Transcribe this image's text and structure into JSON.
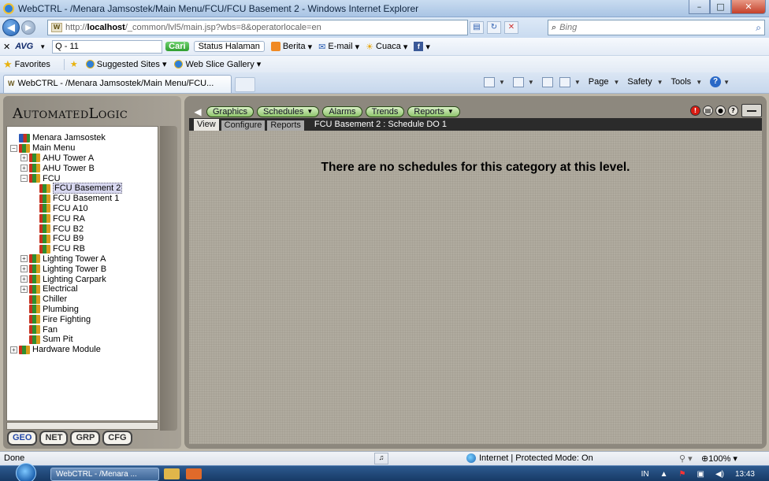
{
  "window": {
    "title": "WebCTRL - /Menara Jamsostek/Main Menu/FCU/FCU Basement 2 - Windows Internet Explorer"
  },
  "address_bar": {
    "url_prefix": "http://",
    "url_host": "localhost",
    "url_path": "/_common/lvl5/main.jsp?wbs=8&operatorlocale=en",
    "search_placeholder": "Bing"
  },
  "avg_toolbar": {
    "brand": "AVG",
    "search_value": "Q - 11",
    "cari_label": "Cari",
    "status_label": "Status Halaman",
    "berita_label": "Berita",
    "email_label": "E-mail",
    "cuaca_label": "Cuaca"
  },
  "favorites_bar": {
    "favorites_label": "Favorites",
    "suggested_label": "Suggested Sites",
    "webslice_label": "Web Slice Gallery"
  },
  "tab": {
    "label": "WebCTRL - /Menara Jamsostek/Main Menu/FCU..."
  },
  "command_bar": {
    "page_label": "Page",
    "safety_label": "Safety",
    "tools_label": "Tools"
  },
  "app": {
    "logo": "AutomatedLogic",
    "nav_buttons": [
      {
        "label": "Graphics",
        "has_menu": false
      },
      {
        "label": "Schedules",
        "has_menu": true
      },
      {
        "label": "Alarms",
        "has_menu": false
      },
      {
        "label": "Trends",
        "has_menu": false
      },
      {
        "label": "Reports",
        "has_menu": true
      }
    ],
    "subtabs": [
      "View",
      "Configure",
      "Reports"
    ],
    "active_subtab": "View",
    "breadcrumb": "FCU Basement 2 : Schedule DO 1",
    "message": "There are no schedules for this category at this level.",
    "tree": [
      {
        "label": "Menara Jamsostek",
        "indent": 0,
        "expander": "",
        "icon": "root"
      },
      {
        "label": "Main Menu",
        "indent": 0,
        "expander": "−",
        "icon": "building"
      },
      {
        "label": "AHU Tower A",
        "indent": 1,
        "expander": "+",
        "icon": "building"
      },
      {
        "label": "AHU Tower B",
        "indent": 1,
        "expander": "+",
        "icon": "building"
      },
      {
        "label": "FCU",
        "indent": 1,
        "expander": "−",
        "icon": "building"
      },
      {
        "label": "FCU Basement 2",
        "indent": 2,
        "expander": "",
        "icon": "building",
        "selected": true
      },
      {
        "label": "FCU Basement 1",
        "indent": 2,
        "expander": "",
        "icon": "building"
      },
      {
        "label": "FCU A10",
        "indent": 2,
        "expander": "",
        "icon": "building"
      },
      {
        "label": "FCU RA",
        "indent": 2,
        "expander": "",
        "icon": "building"
      },
      {
        "label": "FCU B2",
        "indent": 2,
        "expander": "",
        "icon": "building"
      },
      {
        "label": "FCU B9",
        "indent": 2,
        "expander": "",
        "icon": "building"
      },
      {
        "label": "FCU RB",
        "indent": 2,
        "expander": "",
        "icon": "building"
      },
      {
        "label": "Lighting Tower A",
        "indent": 1,
        "expander": "+",
        "icon": "building"
      },
      {
        "label": "Lighting Tower B",
        "indent": 1,
        "expander": "+",
        "icon": "building"
      },
      {
        "label": "Lighting Carpark",
        "indent": 1,
        "expander": "+",
        "icon": "building"
      },
      {
        "label": "Electrical",
        "indent": 1,
        "expander": "+",
        "icon": "building"
      },
      {
        "label": "Chiller",
        "indent": 1,
        "expander": "",
        "icon": "building"
      },
      {
        "label": "Plumbing",
        "indent": 1,
        "expander": "",
        "icon": "building"
      },
      {
        "label": "Fire Fighting",
        "indent": 1,
        "expander": "",
        "icon": "building"
      },
      {
        "label": "Fan",
        "indent": 1,
        "expander": "",
        "icon": "building"
      },
      {
        "label": "Sum Pit",
        "indent": 1,
        "expander": "",
        "icon": "building"
      },
      {
        "label": "Hardware Module",
        "indent": 0,
        "expander": "+",
        "icon": "building"
      }
    ],
    "tree_tabs": [
      "GEO",
      "NET",
      "GRP",
      "CFG"
    ]
  },
  "status_bar": {
    "status": "Done",
    "zone": "Internet | Protected Mode: On",
    "zoom": "100%"
  },
  "taskbar": {
    "ie_button": "WebCTRL - /Menara ...",
    "lang": "IN",
    "time": "13:43"
  },
  "colors": {
    "nav_pill": "#8fc46c",
    "subtab_bar": "#2b2b2b",
    "panel_bg": "#b0ab9f"
  }
}
